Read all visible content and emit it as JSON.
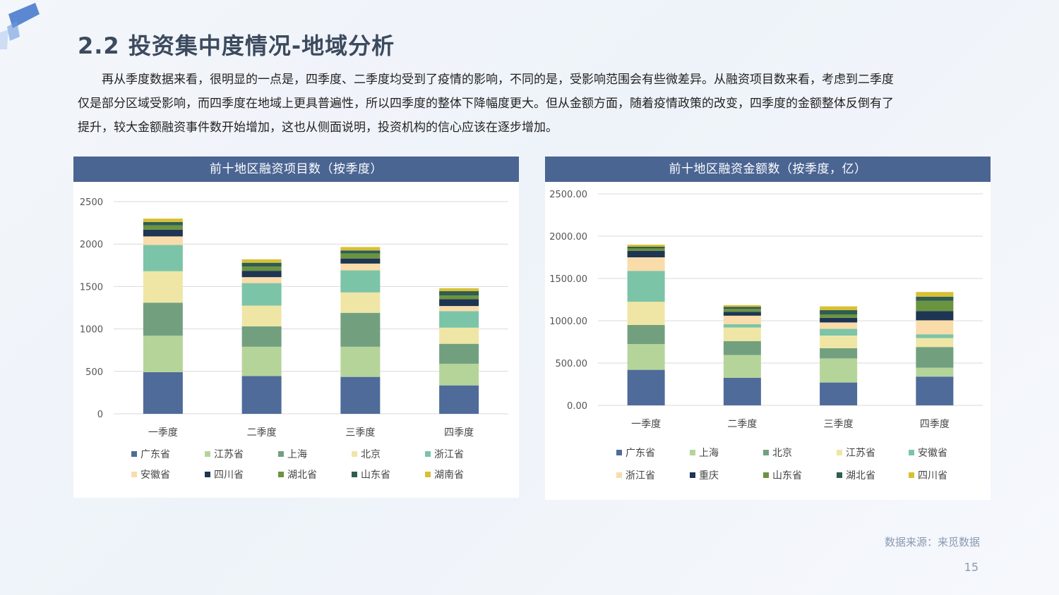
{
  "page": {
    "title": "2.2  投资集中度情况-地域分析",
    "paragraph_lines": [
      "再从季度数据来看，很明显的一点是，四季度、二季度均受到了疫情的影响，不同的是，受影响范围会有些微差异。从融资项目数来看，考虑到二季度",
      "仅是部分区域受影响，而四季度在地域上更具普遍性，所以四季度的整体下降幅度更大。但从金额方面，随着疫情政策的改变，四季度的金额整体反倒有了",
      "提升，较大金额融资事件数开始增加，这也从侧面说明，投资机构的信心应该在逐步增加。"
    ],
    "source": "数据来源：来觅数据",
    "page_number": "15",
    "colors": {
      "header_bg": "#4a6592",
      "title_text": "#3c4a5e"
    }
  },
  "chart_data": [
    {
      "type": "bar",
      "stacked": true,
      "title": "前十地区融资项目数（按季度）",
      "categories": [
        "一季度",
        "二季度",
        "三季度",
        "四季度"
      ],
      "ylim": [
        0,
        2500
      ],
      "yticks": [
        "0",
        "500",
        "1000",
        "1500",
        "2000",
        "2500"
      ],
      "grid": true,
      "legend_position": "bottom",
      "series": [
        {
          "name": "广东省",
          "color": "#4e6b9a",
          "values": [
            490,
            445,
            435,
            335
          ]
        },
        {
          "name": "江苏省",
          "color": "#b5d49a",
          "values": [
            430,
            345,
            355,
            255
          ]
        },
        {
          "name": "上海",
          "color": "#72a07f",
          "values": [
            390,
            240,
            400,
            235
          ]
        },
        {
          "name": "北京",
          "color": "#efe6a5",
          "values": [
            370,
            245,
            240,
            190
          ]
        },
        {
          "name": "浙江省",
          "color": "#7cc4a7",
          "values": [
            310,
            265,
            260,
            195
          ]
        },
        {
          "name": "安徽省",
          "color": "#f9dca9",
          "values": [
            100,
            70,
            80,
            60
          ]
        },
        {
          "name": "四川省",
          "color": "#1e3553",
          "values": [
            80,
            75,
            60,
            80
          ]
        },
        {
          "name": "湖北省",
          "color": "#6b9440",
          "values": [
            50,
            50,
            60,
            45
          ]
        },
        {
          "name": "山东省",
          "color": "#2f5d52",
          "values": [
            40,
            45,
            35,
            50
          ]
        },
        {
          "name": "湖南省",
          "color": "#d8c035",
          "values": [
            40,
            40,
            40,
            35
          ]
        }
      ]
    },
    {
      "type": "bar",
      "stacked": true,
      "title": "前十地区融资金额数（按季度，亿）",
      "categories": [
        "一季度",
        "二季度",
        "三季度",
        "四季度"
      ],
      "ylim": [
        0,
        2500
      ],
      "yticks": [
        "0.00",
        "500.00",
        "1000.00",
        "1500.00",
        "2000.00",
        "2500.00"
      ],
      "grid": true,
      "legend_position": "bottom",
      "series": [
        {
          "name": "广东省",
          "color": "#4e6b9a",
          "values": [
            420,
            325,
            270,
            340
          ]
        },
        {
          "name": "上海",
          "color": "#b5d49a",
          "values": [
            305,
            270,
            285,
            105
          ]
        },
        {
          "name": "北京",
          "color": "#72a07f",
          "values": [
            225,
            165,
            120,
            245
          ]
        },
        {
          "name": "江苏省",
          "color": "#efe6a5",
          "values": [
            275,
            160,
            150,
            105
          ]
        },
        {
          "name": "安徽省",
          "color": "#7cc4a7",
          "values": [
            365,
            40,
            80,
            45
          ]
        },
        {
          "name": "浙江省",
          "color": "#f9dca9",
          "values": [
            160,
            100,
            75,
            165
          ]
        },
        {
          "name": "重庆",
          "color": "#1e3553",
          "values": [
            75,
            45,
            55,
            110
          ]
        },
        {
          "name": "山东省",
          "color": "#6b9440",
          "values": [
            30,
            35,
            40,
            120
          ]
        },
        {
          "name": "湖北省",
          "color": "#2f5d52",
          "values": [
            20,
            25,
            50,
            50
          ]
        },
        {
          "name": "四川省",
          "color": "#d8c035",
          "values": [
            25,
            20,
            45,
            55
          ]
        }
      ]
    }
  ]
}
